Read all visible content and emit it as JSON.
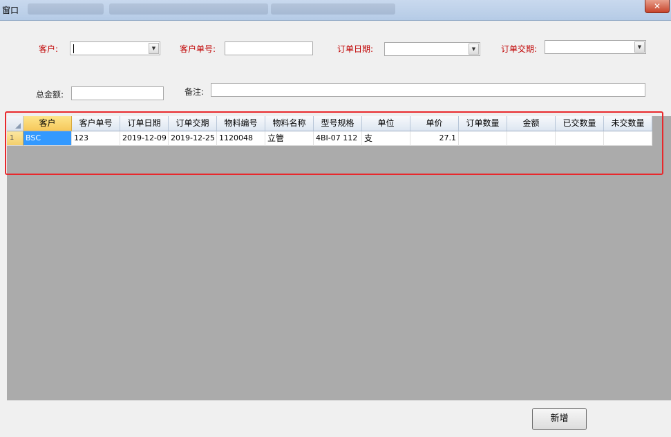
{
  "window": {
    "title": "窗口",
    "close_label": "✕"
  },
  "form": {
    "customer_label": "客户:",
    "customer_value": "",
    "customer_no_label": "客户单号:",
    "customer_no_value": "",
    "order_date_label": "订单日期:",
    "order_date_value": "",
    "delivery_date_label": "订单交期:",
    "delivery_date_value": "",
    "total_label": "总金额:",
    "total_value": "",
    "remark_label": "备注:",
    "remark_value": ""
  },
  "grid": {
    "columns": [
      "客户",
      "客户单号",
      "订单日期",
      "订单交期",
      "物料编号",
      "物料名称",
      "型号规格",
      "单位",
      "单价",
      "订单数量",
      "金额",
      "已交数量",
      "未交数量"
    ],
    "rows": [
      {
        "index": "1",
        "cells": [
          "BSC",
          "123",
          "2019-12-09",
          "2019-12-25",
          "1120048",
          "立管",
          "4BI-07 112",
          "支",
          "27.1",
          "",
          "",
          "",
          ""
        ]
      }
    ]
  },
  "actions": {
    "add_label": "新增"
  },
  "colors": {
    "required_label": "#c00000",
    "highlight": "#e8282c",
    "selected_cell": "#3399ff",
    "grid_bg": "#ababab"
  }
}
